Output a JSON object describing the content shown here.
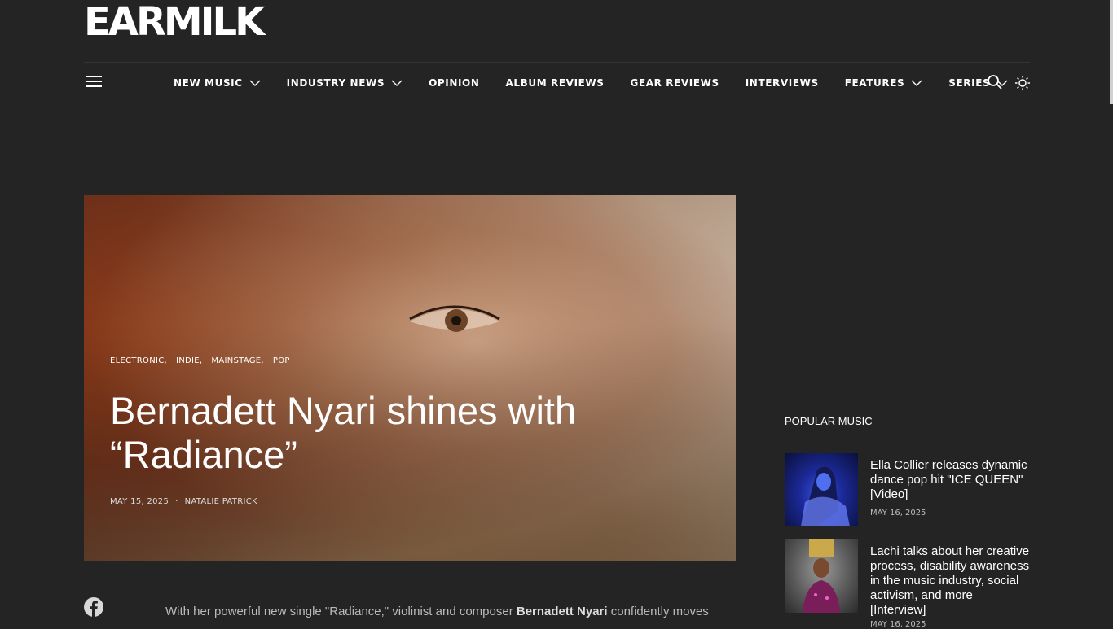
{
  "header": {
    "logo_text": "EARMILK"
  },
  "nav": {
    "menu_icon": "hamburger-icon",
    "items": [
      {
        "label": "NEW MUSIC",
        "dropdown": true
      },
      {
        "label": "INDUSTRY NEWS",
        "dropdown": true
      },
      {
        "label": "OPINION",
        "dropdown": false
      },
      {
        "label": "ALBUM REVIEWS",
        "dropdown": false
      },
      {
        "label": "GEAR REVIEWS",
        "dropdown": false
      },
      {
        "label": "INTERVIEWS",
        "dropdown": false
      },
      {
        "label": "FEATURES",
        "dropdown": true
      },
      {
        "label": "SERIES",
        "dropdown": true
      }
    ],
    "search_icon": "search-icon",
    "theme_icon": "sun-icon"
  },
  "hero": {
    "categories": [
      "ELECTRONIC,",
      "INDIE,",
      "MAINSTAGE,",
      "POP"
    ],
    "title": "Bernadett Nyari shines with “Radiance”",
    "date": "MAY 15, 2025",
    "separator": "·",
    "author": "NATALIE PATRICK"
  },
  "article": {
    "intro_before": "With her powerful new single \"Radiance,\" violinist and composer ",
    "intro_bold": "Bernadett Nyari",
    "intro_after": " confidently moves"
  },
  "sidebar": {
    "popular_title": "POPULAR MUSIC",
    "items": [
      {
        "title": "Ella Collier releases dynamic dance pop hit \"ICE QUEEN\" [Video]",
        "date": "MAY 16, 2025"
      },
      {
        "title": "Lachi talks about her creative process, disability awareness in the music industry, social activism, and more [Interview]",
        "date": "MAY 16, 2025"
      }
    ]
  },
  "colors": {
    "background": "#242424",
    "text": "#ffffff",
    "muted": "#bbbbbb"
  }
}
